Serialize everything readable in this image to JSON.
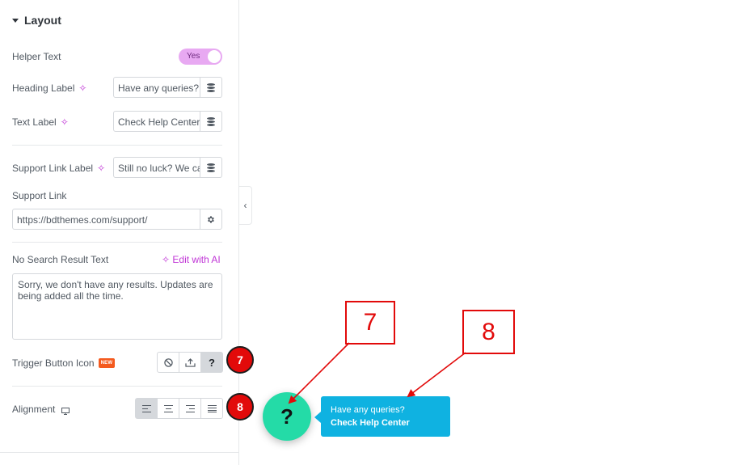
{
  "panel": {
    "section_title": "Layout",
    "helper_text": {
      "label": "Helper Text",
      "toggle_value": "Yes"
    },
    "heading_label": {
      "label": "Heading Label",
      "value": "Have any queries?"
    },
    "text_label": {
      "label": "Text Label",
      "value": "Check Help Center"
    },
    "support_link_label": {
      "label": "Support Link Label",
      "value": "Still no luck? We can help!"
    },
    "support_link": {
      "label": "Support Link",
      "value": "https://bdthemes.com/support/"
    },
    "no_search_result": {
      "label": "No Search Result Text",
      "edit_ai": "Edit with AI",
      "value": "Sorry, we don't have any results. Updates are being added all the time."
    },
    "trigger_button_icon": {
      "label": "Trigger Button Icon",
      "badge": "NEW",
      "question_glyph": "?"
    },
    "alignment": {
      "label": "Alignment"
    }
  },
  "annotations": {
    "seven": "7",
    "eight": "8"
  },
  "preview": {
    "fab_glyph": "?",
    "tooltip_heading": "Have any queries?",
    "tooltip_text": "Check Help Center"
  },
  "colors": {
    "accent_ai": "#c036d6",
    "toggle_on": "#e8a9f2",
    "annotation_red": "#e20a0a",
    "fab_green": "#24dba7",
    "tooltip_blue": "#0fb2e1"
  }
}
